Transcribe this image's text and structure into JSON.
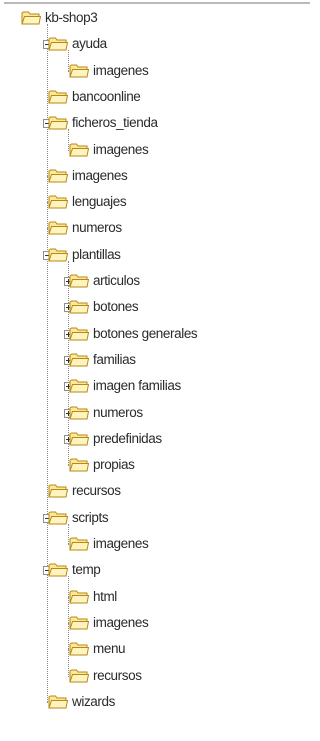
{
  "colors": {
    "folder_fill": "#ffe79a",
    "folder_edge": "#b48a14",
    "tree_line": "#8a8a8a",
    "text": "#2a2a2a"
  },
  "tree": [
    {
      "label": "kb-shop3",
      "level": 0,
      "expander": "minus"
    },
    {
      "label": "ayuda",
      "level": 1,
      "expander": "minus"
    },
    {
      "label": "imagenes",
      "level": 2,
      "expander": "none"
    },
    {
      "label": "bancoonline",
      "level": 1,
      "expander": "none"
    },
    {
      "label": "ficheros_tienda",
      "level": 1,
      "expander": "minus"
    },
    {
      "label": "imagenes",
      "level": 2,
      "expander": "none"
    },
    {
      "label": "imagenes",
      "level": 1,
      "expander": "none"
    },
    {
      "label": "lenguajes",
      "level": 1,
      "expander": "none"
    },
    {
      "label": "numeros",
      "level": 1,
      "expander": "none"
    },
    {
      "label": "plantillas",
      "level": 1,
      "expander": "minus"
    },
    {
      "label": "articulos",
      "level": 2,
      "expander": "plus"
    },
    {
      "label": "botones",
      "level": 2,
      "expander": "plus"
    },
    {
      "label": "botones generales",
      "level": 2,
      "expander": "plus"
    },
    {
      "label": "familias",
      "level": 2,
      "expander": "plus"
    },
    {
      "label": "imagen familias",
      "level": 2,
      "expander": "plus"
    },
    {
      "label": "numeros",
      "level": 2,
      "expander": "plus"
    },
    {
      "label": "predefinidas",
      "level": 2,
      "expander": "plus"
    },
    {
      "label": "propias",
      "level": 2,
      "expander": "none"
    },
    {
      "label": "recursos",
      "level": 1,
      "expander": "none"
    },
    {
      "label": "scripts",
      "level": 1,
      "expander": "minus"
    },
    {
      "label": "imagenes",
      "level": 2,
      "expander": "none"
    },
    {
      "label": "temp",
      "level": 1,
      "expander": "minus"
    },
    {
      "label": "html",
      "level": 2,
      "expander": "none"
    },
    {
      "label": "imagenes",
      "level": 2,
      "expander": "none"
    },
    {
      "label": "menu",
      "level": 2,
      "expander": "none"
    },
    {
      "label": "recursos",
      "level": 2,
      "expander": "none"
    },
    {
      "label": "wizards",
      "level": 1,
      "expander": "none"
    }
  ]
}
